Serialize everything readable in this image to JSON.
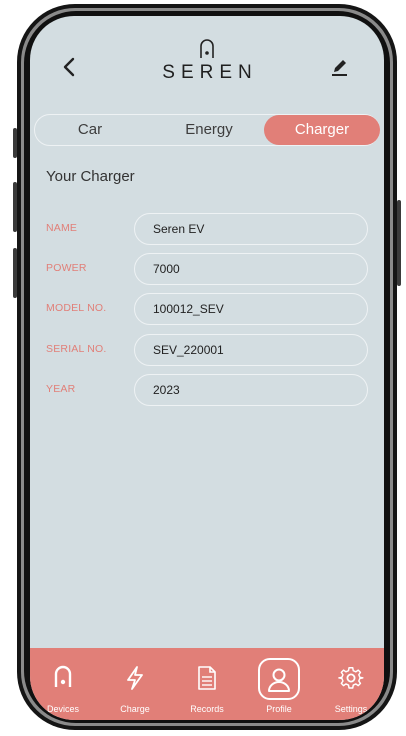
{
  "header": {
    "brand": "SEREN"
  },
  "tabs": [
    {
      "label": "Car",
      "active": false
    },
    {
      "label": "Energy",
      "active": false
    },
    {
      "label": "Charger",
      "active": true
    }
  ],
  "section_title": "Your Charger",
  "fields": [
    {
      "label": "NAME",
      "value": "Seren EV"
    },
    {
      "label": "POWER",
      "value": "7000"
    },
    {
      "label": "MODEL NO.",
      "value": "100012_SEV"
    },
    {
      "label": "SERIAL NO.",
      "value": "SEV_220001"
    },
    {
      "label": "YEAR",
      "value": "2023"
    }
  ],
  "nav": [
    {
      "label": "Devices",
      "icon": "charger-plug-icon",
      "active": false
    },
    {
      "label": "Charge",
      "icon": "lightning-icon",
      "active": false
    },
    {
      "label": "Records",
      "icon": "document-icon",
      "active": false
    },
    {
      "label": "Profile",
      "icon": "user-icon",
      "active": true
    },
    {
      "label": "Settings",
      "icon": "gear-icon",
      "active": false
    }
  ],
  "colors": {
    "accent": "#e17f78",
    "screen_background": "#d3dde1",
    "text": "#333333"
  }
}
